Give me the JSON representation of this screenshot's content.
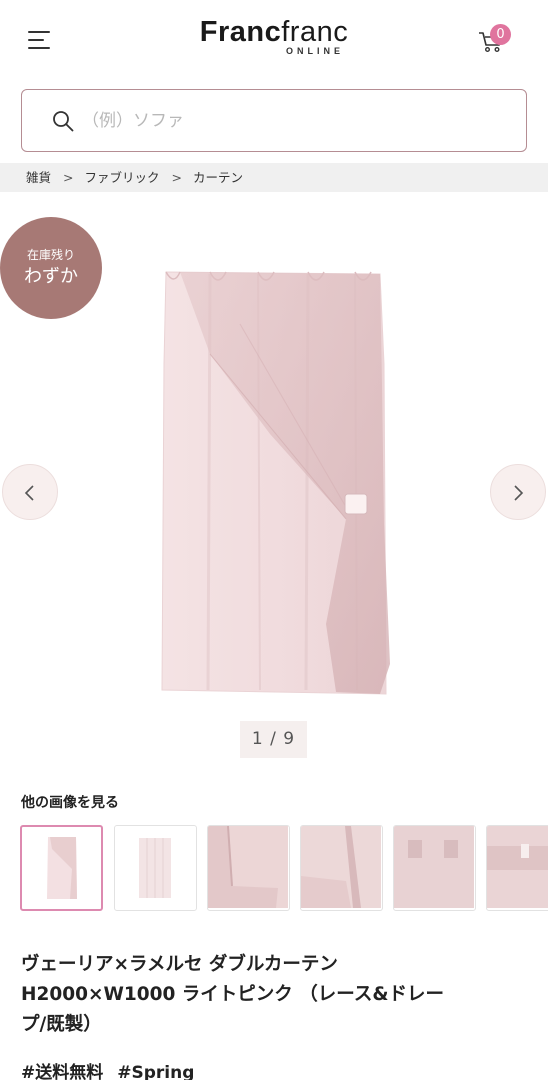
{
  "header": {
    "logo_main_bold": "Franc",
    "logo_main_light": "franc",
    "logo_sub": "ONLINE",
    "cart_count": "0"
  },
  "search": {
    "placeholder": "（例）ソファ"
  },
  "breadcrumb": {
    "items": [
      "雑貨",
      "ファブリック",
      "カーテン"
    ],
    "separator": ">"
  },
  "gallery": {
    "stock_badge_line1": "在庫残り",
    "stock_badge_line2": "わずか",
    "pager": "1 / 9",
    "badge_color": "#a77975",
    "curtain_color": "#f3e1e2"
  },
  "thumbnails": {
    "title": "他の画像を見る",
    "active_border_color": "#dd8ab0"
  },
  "product": {
    "title_line1": "ヴェーリア×ラメルセ ダブルカーテン",
    "title_line2": "H2000×W1000 ライトピンク （レース&ドレー",
    "title_line3": "プ/既製）",
    "tags": [
      "#送料無料",
      "#Spring"
    ]
  }
}
